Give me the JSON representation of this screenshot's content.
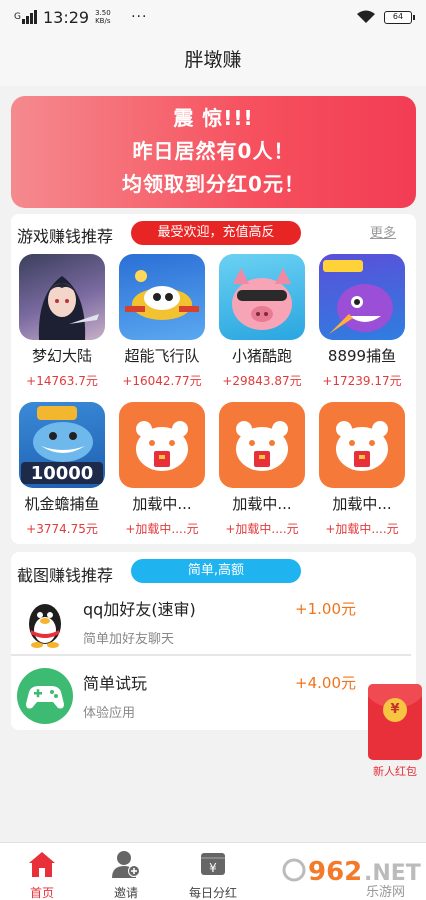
{
  "status_bar": {
    "carrier": "G",
    "time": "13:29",
    "speed": "3.50 KB/s",
    "dots": "···",
    "battery": "64"
  },
  "header": {
    "title": "胖墩赚"
  },
  "banner": {
    "line1": "震 惊!!!",
    "line2": "昨日居然有0人！",
    "line3": "均领取到分红0元！"
  },
  "games_section": {
    "title": "游戏赚钱推荐",
    "badge": "最受欢迎，充值高反",
    "more": "更多",
    "items": [
      {
        "name": "梦幻大陆",
        "reward": "+14763.7元",
        "icon": "fantasy-girl-icon"
      },
      {
        "name": "超能飞行队",
        "reward": "+16042.77元",
        "icon": "flying-team-icon"
      },
      {
        "name": "小猪酷跑",
        "reward": "+29843.87元",
        "icon": "pig-icon"
      },
      {
        "name": "8899捕鱼",
        "reward": "+17239.17元",
        "icon": "fishing-monster-icon"
      },
      {
        "name": "机金蟾捕鱼",
        "reward": "+3774.75元",
        "icon": "shark-10000-icon"
      },
      {
        "name": "加载中...",
        "reward": "+加载中....元",
        "icon": "hamster-placeholder-icon"
      },
      {
        "name": "加载中...",
        "reward": "+加载中....元",
        "icon": "hamster-placeholder-icon"
      },
      {
        "name": "加载中...",
        "reward": "+加载中....元",
        "icon": "hamster-placeholder-icon"
      }
    ]
  },
  "shots_section": {
    "title": "截图赚钱推荐",
    "badge": "简单,高额",
    "tasks": [
      {
        "title": "qq加好友(速审)",
        "subtitle": "简单加好友聊天",
        "reward": "+1.00元",
        "icon": "qq-penguin-icon"
      },
      {
        "title": "简单试玩",
        "subtitle": "体验应用",
        "reward": "+4.00元",
        "icon": "gamepad-icon"
      }
    ]
  },
  "red_packet": {
    "label": "新人红包",
    "symbol": "¥"
  },
  "tabbar": {
    "tabs": [
      {
        "label": "首页",
        "icon": "home-icon",
        "active": true
      },
      {
        "label": "邀请",
        "icon": "invite-user-icon",
        "active": false
      },
      {
        "label": "每日分红",
        "icon": "wallet-yen-icon",
        "active": false
      }
    ]
  },
  "watermark": {
    "text": "962.NET",
    "subtext": "乐游网"
  },
  "colors": {
    "accent": "#e8303a",
    "banner_from": "#f58a8e",
    "banner_to": "#f23d54",
    "reward_orange": "#f0741c",
    "pill_blue": "#1fb3f0",
    "loading_orange": "#f57a3a"
  }
}
